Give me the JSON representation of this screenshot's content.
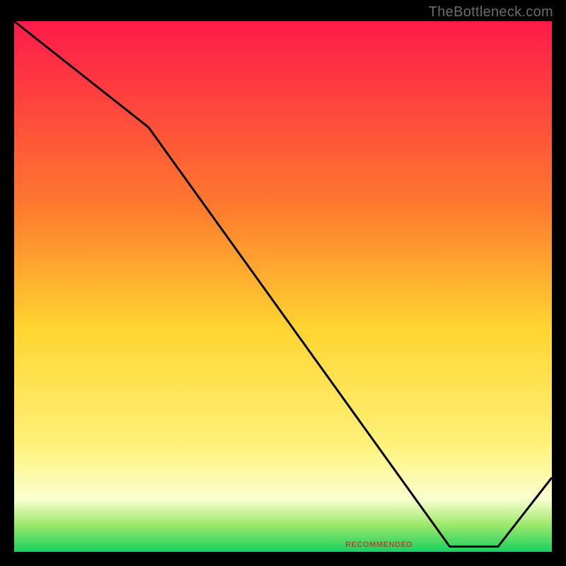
{
  "attribution": "TheBottleneck.com",
  "footer_label": "RECOMMENDED",
  "colors": {
    "gradient_top": "#ff1a4a",
    "gradient_mid1": "#ff7a2e",
    "gradient_mid2": "#ffd531",
    "gradient_mid3": "#fff27a",
    "gradient_low": "#fbffd0",
    "gradient_green_top": "#9be86a",
    "gradient_green_bottom": "#18d060",
    "line": "#000000",
    "frame": "#000000"
  },
  "chart_data": {
    "type": "line",
    "title": "",
    "xlabel": "",
    "ylabel": "",
    "xlim": [
      0,
      100
    ],
    "ylim": [
      0,
      100
    ],
    "series": [
      {
        "name": "curve",
        "points": [
          {
            "x": 0,
            "y": 100
          },
          {
            "x": 25,
            "y": 80
          },
          {
            "x": 81,
            "y": 1
          },
          {
            "x": 90,
            "y": 1
          },
          {
            "x": 100,
            "y": 14
          }
        ]
      }
    ],
    "optimum_band": {
      "x_start": 81,
      "x_end": 90
    },
    "gradient_stops": [
      {
        "offset": 0.0,
        "color_key": "gradient_top"
      },
      {
        "offset": 0.35,
        "color_key": "gradient_mid1"
      },
      {
        "offset": 0.58,
        "color_key": "gradient_mid2"
      },
      {
        "offset": 0.8,
        "color_key": "gradient_mid3"
      },
      {
        "offset": 0.9,
        "color_key": "gradient_low"
      },
      {
        "offset": 0.95,
        "color_key": "gradient_green_top"
      },
      {
        "offset": 1.0,
        "color_key": "gradient_green_bottom"
      }
    ]
  }
}
